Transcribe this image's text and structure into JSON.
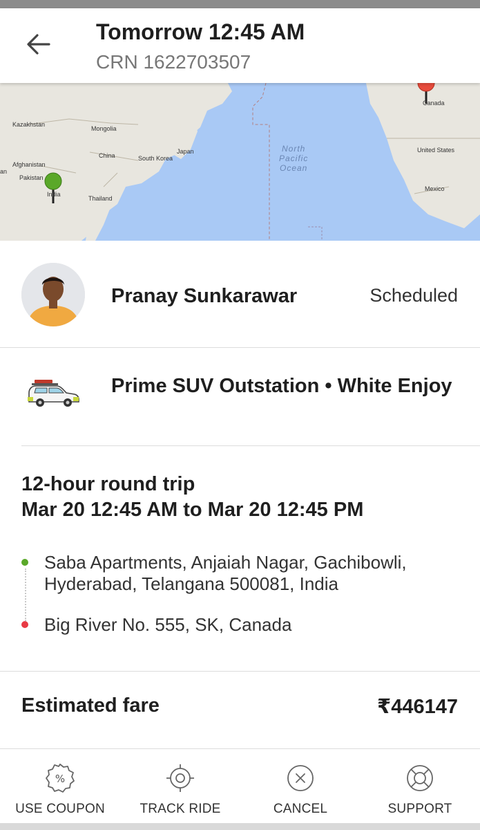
{
  "header": {
    "title": "Tomorrow 12:45 AM",
    "crn": "CRN 1622703507"
  },
  "map": {
    "labels": {
      "kazakhstan": "Kazakhstan",
      "mongolia": "Mongolia",
      "china": "China",
      "south_korea": "South Korea",
      "japan": "Japan",
      "afghanistan": "Afghanistan",
      "pakistan": "Pakistan",
      "india": "India",
      "thailand": "Thailand",
      "canada": "Canada",
      "united_states": "United States",
      "mexico": "Mexico",
      "an": "an",
      "ocean": "North\nPacific\nOcean"
    },
    "pickup_marker_color": "#5aa829",
    "drop_marker_color": "#e84c3d",
    "water_color": "#a9c9f5",
    "land_color": "#e8e6df"
  },
  "driver": {
    "name": "Pranay Sunkarawar",
    "status": "Scheduled"
  },
  "car": {
    "description": "Prime SUV Outstation • White Enjoy",
    "icon": "car-icon"
  },
  "trip": {
    "type": "12-hour round trip",
    "schedule": "Mar 20 12:45 AM to Mar 20 12:45 PM",
    "pickup": "Saba Apartments, Anjaiah Nagar, Gachibowli, Hyderabad, Telangana 500081, India",
    "drop": "Big River No. 555, SK, Canada",
    "pickup_color": "#5aa829",
    "drop_color": "#e83a44"
  },
  "fare": {
    "label": "Estimated fare",
    "value": "₹446147"
  },
  "actions": [
    {
      "label": "USE COUPON",
      "icon": "coupon-icon"
    },
    {
      "label": "TRACK RIDE",
      "icon": "track-ride-icon"
    },
    {
      "label": "CANCEL",
      "icon": "cancel-icon"
    },
    {
      "label": "SUPPORT",
      "icon": "support-icon"
    }
  ]
}
